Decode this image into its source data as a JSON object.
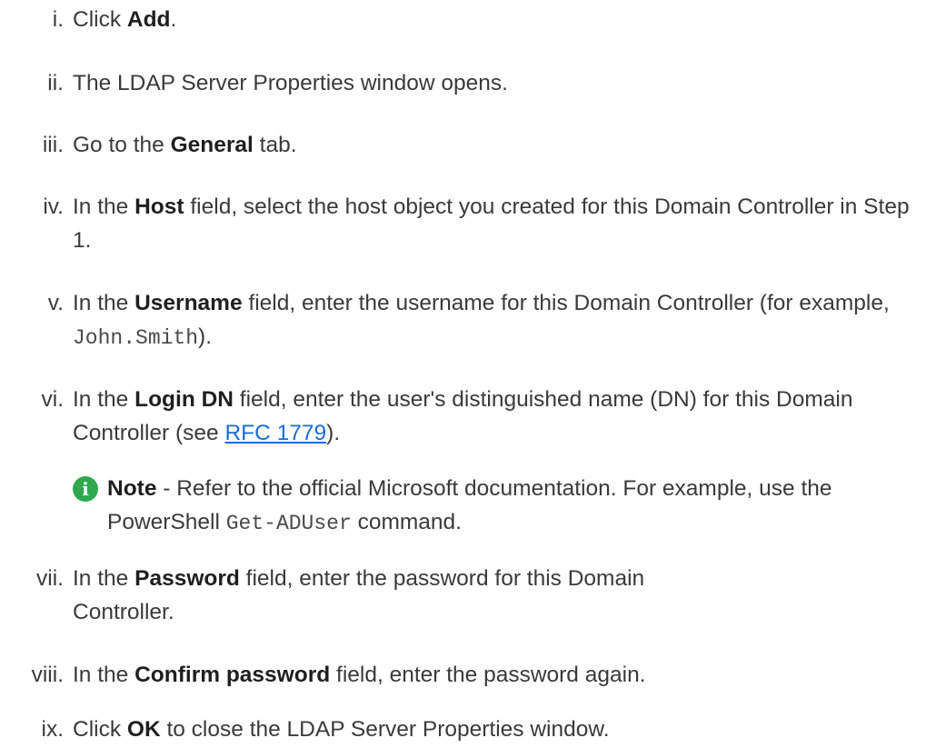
{
  "steps": [
    {
      "num": "i.",
      "p1": "Click ",
      "b1": "Add",
      "p2": "."
    },
    {
      "num": "ii.",
      "text": "The LDAP Server Properties window opens."
    },
    {
      "num": "iii.",
      "p1": "Go to the ",
      "b1": "General",
      "p2": " tab."
    },
    {
      "num": "iv.",
      "p1": "In the ",
      "b1": "Host",
      "p2": " field, select the host object you created for this Domain Controller in Step 1."
    },
    {
      "num": "v.",
      "p1": "In the ",
      "b1": "Username",
      "p2": " field, enter the username for this Domain Controller (for example, ",
      "code": "John.Smith",
      "p3": ")."
    },
    {
      "num": "vi.",
      "p1": "In the ",
      "b1": "Login DN",
      "p2": " field, enter the user's distinguished name (DN) for this Domain Controller (see ",
      "link": "RFC 1779",
      "p3": ")."
    },
    {
      "num": "vii.",
      "p1": "In the ",
      "b1": "Password",
      "p2": " field, enter the password for this Domain Controller."
    },
    {
      "num": "viii.",
      "p1": "In the ",
      "b1": "Confirm password",
      "p2": " field, enter the password again."
    },
    {
      "num": "ix.",
      "p1": "Click ",
      "b1": "OK",
      "p2": " to close the LDAP Server Properties window."
    }
  ],
  "note": {
    "icon": "info-icon",
    "icon_glyph": "i",
    "label": "Note",
    "t1": " - Refer to the official Microsoft documentation. For example, use the PowerShell ",
    "code": "Get-ADUser",
    "t2": " command."
  },
  "colors": {
    "text": "#3a3a3a",
    "link": "#1a6fd6",
    "note_icon": "#2fa84f"
  }
}
